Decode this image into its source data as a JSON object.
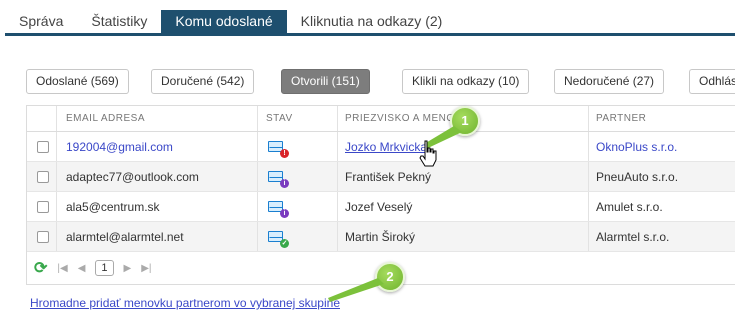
{
  "tabs": [
    {
      "label": "Správa",
      "active": false
    },
    {
      "label": "Štatistiky",
      "active": false
    },
    {
      "label": "Komu odoslané",
      "active": true
    },
    {
      "label": "Kliknutia na odkazy (2)",
      "active": false
    }
  ],
  "filters": [
    {
      "label": "Odoslané (569)",
      "active": false
    },
    {
      "label": "Doručené (542)",
      "active": false
    },
    {
      "label": "Otvorili (151)",
      "active": true
    },
    {
      "label": "Klikli na odkazy (10)",
      "active": false
    },
    {
      "label": "Nedoručené (27)",
      "active": false
    },
    {
      "label": "Odhlás",
      "active": false
    }
  ],
  "table": {
    "columns": [
      "EMAIL ADRESA",
      "STAV",
      "PRIEZVISKO A MENO",
      "PARTNER"
    ],
    "rows": [
      {
        "email": "192004@gmail.com",
        "status": "error",
        "name": "Jozko Mrkvicka",
        "partner": "OknoPlus s.r.o.",
        "linked": true
      },
      {
        "email": "adaptec77@outlook.com",
        "status": "info",
        "name": "František Pekný",
        "partner": "PneuAuto s.r.o.",
        "linked": false
      },
      {
        "email": "ala5@centrum.sk",
        "status": "info",
        "name": "Jozef Veselý",
        "partner": "Amulet s.r.o.",
        "linked": false
      },
      {
        "email": "alarmtel@alarmtel.net",
        "status": "ok",
        "name": "Martin Široký",
        "partner": "Alarmtel s.r.o.",
        "linked": false
      }
    ]
  },
  "pager": {
    "current_page": "1",
    "icons": [
      "refresh-icon",
      "first-page-icon",
      "prev-page-icon",
      "next-page-icon",
      "last-page-icon"
    ]
  },
  "bulk_link": "Hromadne pridať menovku partnerom vo vybranej skupine",
  "callouts": [
    "1",
    "2"
  ],
  "colors": {
    "tab_active": "#1e4f6e",
    "link": "#3b48c8",
    "callout": "#7cc13b",
    "status_error": "#d9242a",
    "status_info": "#7a3bbf",
    "status_ok": "#38a84a"
  }
}
